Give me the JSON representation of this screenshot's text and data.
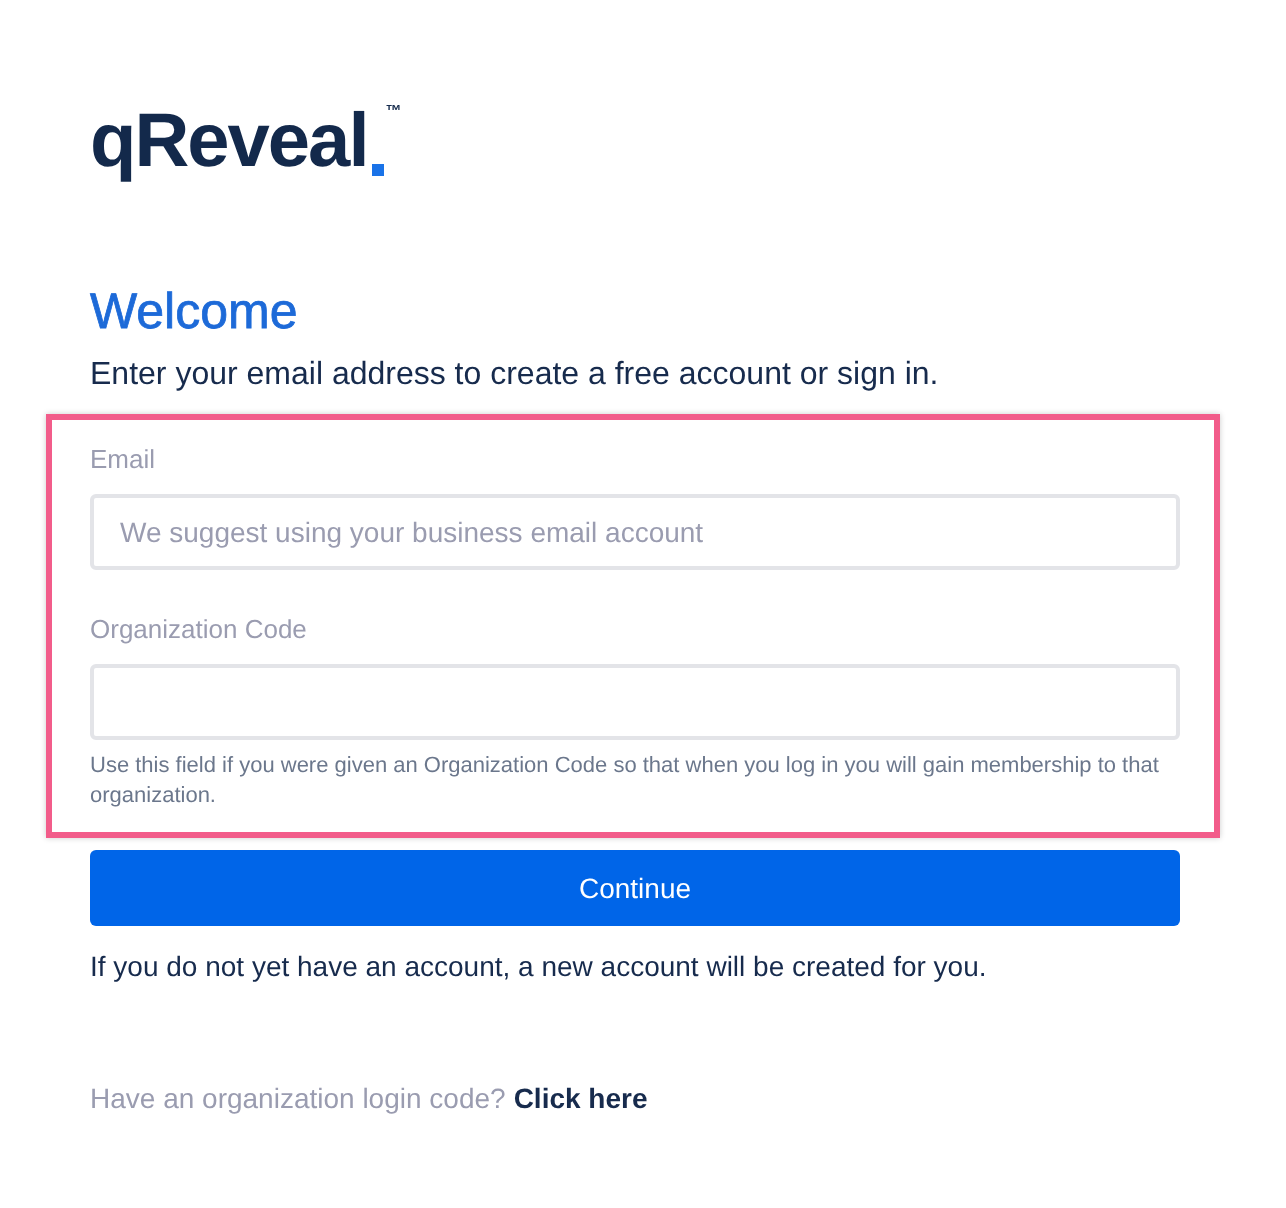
{
  "logo": {
    "text": "qReveal",
    "mark": "™"
  },
  "heading": "Welcome",
  "subtitle": "Enter your email address to create a free account or sign in.",
  "fields": [
    {
      "label": "Email",
      "placeholder": "We suggest using your business email account"
    },
    {
      "label": "Organization Code",
      "help": "Use this field if you were given an Organization Code so that when you log in you will gain membership to that organization."
    }
  ],
  "button": "Continue",
  "note": "If you do not yet have an account, a new account will be created for you.",
  "footer": {
    "text": "Have an organization login code?",
    "link": "Click here"
  }
}
